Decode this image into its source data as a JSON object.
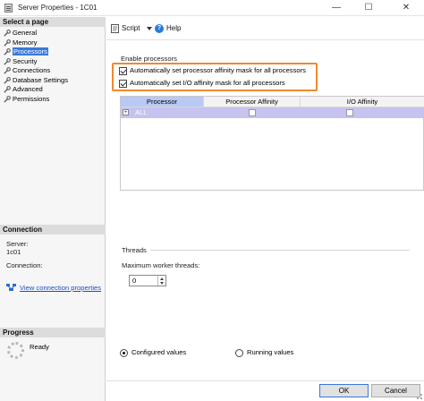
{
  "window": {
    "title": "Server Properties - 1C01",
    "minimize": "—",
    "maximize": "☐",
    "close": "✕"
  },
  "left_pane": {
    "select_page_header": "Select a page",
    "pages": [
      {
        "label": "General",
        "icon": "wrench-icon",
        "selected": false
      },
      {
        "label": "Memory",
        "icon": "wrench-icon",
        "selected": false
      },
      {
        "label": "Processors",
        "icon": "wrench-icon",
        "selected": true
      },
      {
        "label": "Security",
        "icon": "wrench-icon",
        "selected": false
      },
      {
        "label": "Connections",
        "icon": "wrench-icon",
        "selected": false
      },
      {
        "label": "Database Settings",
        "icon": "wrench-icon",
        "selected": false
      },
      {
        "label": "Advanced",
        "icon": "wrench-icon",
        "selected": false
      },
      {
        "label": "Permissions",
        "icon": "wrench-icon",
        "selected": false
      }
    ],
    "connection_header": "Connection",
    "server_label": "Server:",
    "server_value": "1c01",
    "connection_label": "Connection:",
    "view_connection_link": "View connection properties",
    "progress_header": "Progress",
    "progress_status": "Ready"
  },
  "toolbar": {
    "script_label": "Script",
    "help_label": "Help"
  },
  "main": {
    "enable_processors_label": "Enable processors",
    "auto_processor_affinity": {
      "label": "Automatically set processor affinity mask for all processors",
      "checked": true
    },
    "auto_io_affinity": {
      "label": "Automatically set I/O affinity mask for all processors",
      "checked": true
    },
    "grid": {
      "columns": [
        "Processor",
        "Processor Affinity",
        "I/O Affinity"
      ],
      "rows": [
        {
          "expander": "+",
          "processor": "ALL",
          "processor_affinity": false,
          "io_affinity": false
        }
      ]
    },
    "threads_label": "Threads",
    "max_worker_threads_label": "Maximum worker threads:",
    "max_worker_threads_value": "0",
    "configured_values_label": "Configured values",
    "running_values_label": "Running values",
    "selected_mode": "configured"
  },
  "footer": {
    "ok_label": "OK",
    "cancel_label": "Cancel"
  },
  "colors": {
    "selection_blue": "#3b78d8",
    "highlight_orange": "#f08a2c",
    "grid_row_fill": "#c6c3f0"
  }
}
